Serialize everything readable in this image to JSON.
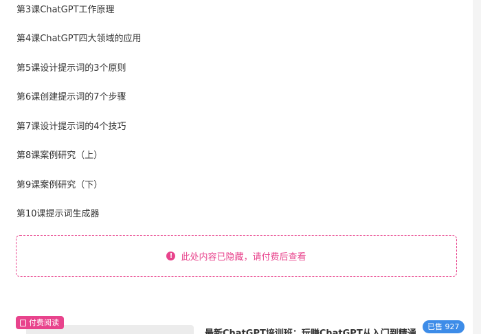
{
  "lessons": [
    "第3课ChatGPT工作原理",
    "第4课ChatGPT四大领域的应用",
    "第5课设计提示词的3个原则",
    "第6课创建提示词的7个步骤",
    "第7课设计提示词的4个技巧",
    "第8课案例研究（上）",
    "第9课案例研究（下）",
    "第10课提示词生成器"
  ],
  "hidden_notice": {
    "icon": "exclamation-circle-icon",
    "text": "此处内容已隐藏，请付费后查看"
  },
  "course_card": {
    "badge_label": "付费阅读",
    "badge_icon": "book-icon",
    "title": "最新ChatGPT培训班：玩赚ChatGPT从入门到精通，自动...",
    "sold_label": "已售 927"
  },
  "colors": {
    "accent_pink": "#e8438c",
    "sold_blue": "#3d8ce8"
  }
}
